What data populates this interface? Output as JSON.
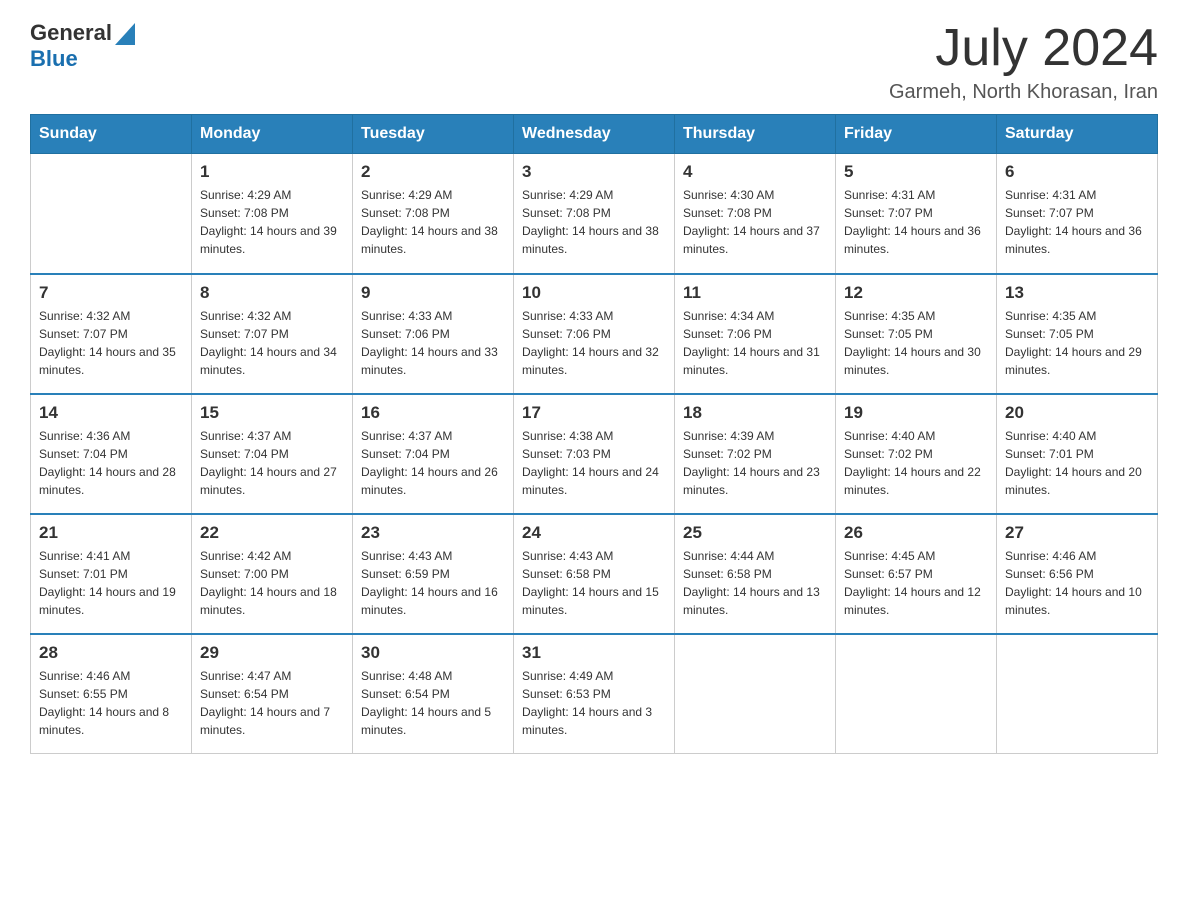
{
  "header": {
    "logo_general": "General",
    "logo_blue": "Blue",
    "month_title": "July 2024",
    "location": "Garmeh, North Khorasan, Iran"
  },
  "days_of_week": [
    "Sunday",
    "Monday",
    "Tuesday",
    "Wednesday",
    "Thursday",
    "Friday",
    "Saturday"
  ],
  "weeks": [
    [
      {
        "day": "",
        "sunrise": "",
        "sunset": "",
        "daylight": ""
      },
      {
        "day": "1",
        "sunrise": "Sunrise: 4:29 AM",
        "sunset": "Sunset: 7:08 PM",
        "daylight": "Daylight: 14 hours and 39 minutes."
      },
      {
        "day": "2",
        "sunrise": "Sunrise: 4:29 AM",
        "sunset": "Sunset: 7:08 PM",
        "daylight": "Daylight: 14 hours and 38 minutes."
      },
      {
        "day": "3",
        "sunrise": "Sunrise: 4:29 AM",
        "sunset": "Sunset: 7:08 PM",
        "daylight": "Daylight: 14 hours and 38 minutes."
      },
      {
        "day": "4",
        "sunrise": "Sunrise: 4:30 AM",
        "sunset": "Sunset: 7:08 PM",
        "daylight": "Daylight: 14 hours and 37 minutes."
      },
      {
        "day": "5",
        "sunrise": "Sunrise: 4:31 AM",
        "sunset": "Sunset: 7:07 PM",
        "daylight": "Daylight: 14 hours and 36 minutes."
      },
      {
        "day": "6",
        "sunrise": "Sunrise: 4:31 AM",
        "sunset": "Sunset: 7:07 PM",
        "daylight": "Daylight: 14 hours and 36 minutes."
      }
    ],
    [
      {
        "day": "7",
        "sunrise": "Sunrise: 4:32 AM",
        "sunset": "Sunset: 7:07 PM",
        "daylight": "Daylight: 14 hours and 35 minutes."
      },
      {
        "day": "8",
        "sunrise": "Sunrise: 4:32 AM",
        "sunset": "Sunset: 7:07 PM",
        "daylight": "Daylight: 14 hours and 34 minutes."
      },
      {
        "day": "9",
        "sunrise": "Sunrise: 4:33 AM",
        "sunset": "Sunset: 7:06 PM",
        "daylight": "Daylight: 14 hours and 33 minutes."
      },
      {
        "day": "10",
        "sunrise": "Sunrise: 4:33 AM",
        "sunset": "Sunset: 7:06 PM",
        "daylight": "Daylight: 14 hours and 32 minutes."
      },
      {
        "day": "11",
        "sunrise": "Sunrise: 4:34 AM",
        "sunset": "Sunset: 7:06 PM",
        "daylight": "Daylight: 14 hours and 31 minutes."
      },
      {
        "day": "12",
        "sunrise": "Sunrise: 4:35 AM",
        "sunset": "Sunset: 7:05 PM",
        "daylight": "Daylight: 14 hours and 30 minutes."
      },
      {
        "day": "13",
        "sunrise": "Sunrise: 4:35 AM",
        "sunset": "Sunset: 7:05 PM",
        "daylight": "Daylight: 14 hours and 29 minutes."
      }
    ],
    [
      {
        "day": "14",
        "sunrise": "Sunrise: 4:36 AM",
        "sunset": "Sunset: 7:04 PM",
        "daylight": "Daylight: 14 hours and 28 minutes."
      },
      {
        "day": "15",
        "sunrise": "Sunrise: 4:37 AM",
        "sunset": "Sunset: 7:04 PM",
        "daylight": "Daylight: 14 hours and 27 minutes."
      },
      {
        "day": "16",
        "sunrise": "Sunrise: 4:37 AM",
        "sunset": "Sunset: 7:04 PM",
        "daylight": "Daylight: 14 hours and 26 minutes."
      },
      {
        "day": "17",
        "sunrise": "Sunrise: 4:38 AM",
        "sunset": "Sunset: 7:03 PM",
        "daylight": "Daylight: 14 hours and 24 minutes."
      },
      {
        "day": "18",
        "sunrise": "Sunrise: 4:39 AM",
        "sunset": "Sunset: 7:02 PM",
        "daylight": "Daylight: 14 hours and 23 minutes."
      },
      {
        "day": "19",
        "sunrise": "Sunrise: 4:40 AM",
        "sunset": "Sunset: 7:02 PM",
        "daylight": "Daylight: 14 hours and 22 minutes."
      },
      {
        "day": "20",
        "sunrise": "Sunrise: 4:40 AM",
        "sunset": "Sunset: 7:01 PM",
        "daylight": "Daylight: 14 hours and 20 minutes."
      }
    ],
    [
      {
        "day": "21",
        "sunrise": "Sunrise: 4:41 AM",
        "sunset": "Sunset: 7:01 PM",
        "daylight": "Daylight: 14 hours and 19 minutes."
      },
      {
        "day": "22",
        "sunrise": "Sunrise: 4:42 AM",
        "sunset": "Sunset: 7:00 PM",
        "daylight": "Daylight: 14 hours and 18 minutes."
      },
      {
        "day": "23",
        "sunrise": "Sunrise: 4:43 AM",
        "sunset": "Sunset: 6:59 PM",
        "daylight": "Daylight: 14 hours and 16 minutes."
      },
      {
        "day": "24",
        "sunrise": "Sunrise: 4:43 AM",
        "sunset": "Sunset: 6:58 PM",
        "daylight": "Daylight: 14 hours and 15 minutes."
      },
      {
        "day": "25",
        "sunrise": "Sunrise: 4:44 AM",
        "sunset": "Sunset: 6:58 PM",
        "daylight": "Daylight: 14 hours and 13 minutes."
      },
      {
        "day": "26",
        "sunrise": "Sunrise: 4:45 AM",
        "sunset": "Sunset: 6:57 PM",
        "daylight": "Daylight: 14 hours and 12 minutes."
      },
      {
        "day": "27",
        "sunrise": "Sunrise: 4:46 AM",
        "sunset": "Sunset: 6:56 PM",
        "daylight": "Daylight: 14 hours and 10 minutes."
      }
    ],
    [
      {
        "day": "28",
        "sunrise": "Sunrise: 4:46 AM",
        "sunset": "Sunset: 6:55 PM",
        "daylight": "Daylight: 14 hours and 8 minutes."
      },
      {
        "day": "29",
        "sunrise": "Sunrise: 4:47 AM",
        "sunset": "Sunset: 6:54 PM",
        "daylight": "Daylight: 14 hours and 7 minutes."
      },
      {
        "day": "30",
        "sunrise": "Sunrise: 4:48 AM",
        "sunset": "Sunset: 6:54 PM",
        "daylight": "Daylight: 14 hours and 5 minutes."
      },
      {
        "day": "31",
        "sunrise": "Sunrise: 4:49 AM",
        "sunset": "Sunset: 6:53 PM",
        "daylight": "Daylight: 14 hours and 3 minutes."
      },
      {
        "day": "",
        "sunrise": "",
        "sunset": "",
        "daylight": ""
      },
      {
        "day": "",
        "sunrise": "",
        "sunset": "",
        "daylight": ""
      },
      {
        "day": "",
        "sunrise": "",
        "sunset": "",
        "daylight": ""
      }
    ]
  ],
  "accent_color": "#2980b9"
}
